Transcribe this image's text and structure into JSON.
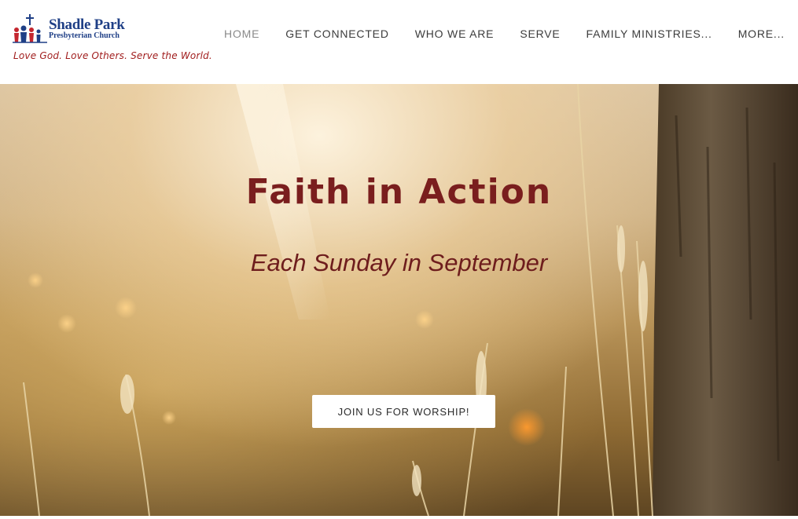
{
  "header": {
    "logo": {
      "name": "Shadle Park",
      "subname": "Presbyterian Church",
      "tagline": "Love God. Love Others. Serve the World."
    },
    "nav": [
      {
        "label": "HOME",
        "active": true
      },
      {
        "label": "GET CONNECTED",
        "active": false
      },
      {
        "label": "WHO WE ARE",
        "active": false
      },
      {
        "label": "SERVE",
        "active": false
      },
      {
        "label": "FAMILY MINISTRIES...",
        "active": false
      },
      {
        "label": "MORE...",
        "active": false
      }
    ]
  },
  "hero": {
    "title": "Faith in Action",
    "subtitle": "Each Sunday in September",
    "button_label": "JOIN US FOR WORSHIP!"
  },
  "colors": {
    "brand_blue": "#1f3f86",
    "brand_red": "#a01c1c",
    "hero_title": "#7a1e1e",
    "nav_text": "#3c3c3c",
    "nav_active": "#8a8a8a"
  }
}
